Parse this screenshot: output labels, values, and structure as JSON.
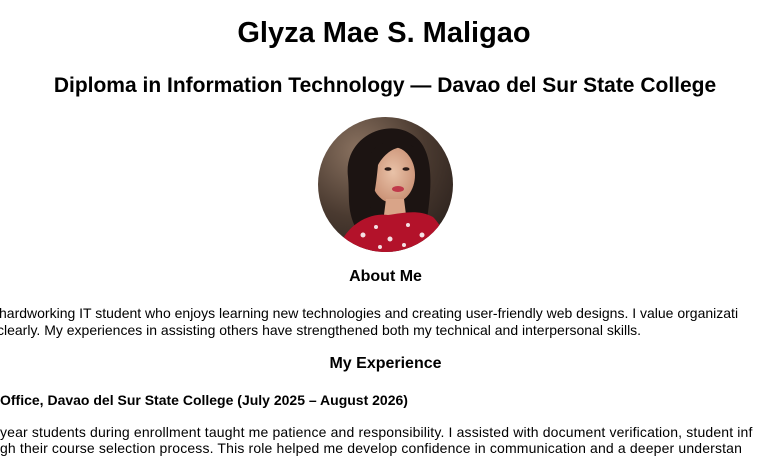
{
  "profile": {
    "name": "Glyza Mae S. Maligao",
    "tagline": "Diploma in Information Technology — Davao del Sur State College"
  },
  "about": {
    "heading": "About Me",
    "lines": [
      "l hardworking IT student who enjoys learning new technologies and creating user-friendly web designs. I value organizati",
      "clearly. My experiences in assisting others have strengthened both my technical and interpersonal skills."
    ]
  },
  "experience": {
    "heading": "My Experience",
    "job_title": "Office, Davao del Sur State College (July 2025 – August 2026)",
    "lines": [
      "year students during enrollment taught me patience and responsibility. I assisted with document verification, student inf",
      "gh their course selection process. This role helped me develop confidence in communication and a deeper understan"
    ]
  },
  "colors": {
    "background": "#ffffff",
    "text": "#000000"
  },
  "icons": {
    "avatar": "profile-photo"
  }
}
